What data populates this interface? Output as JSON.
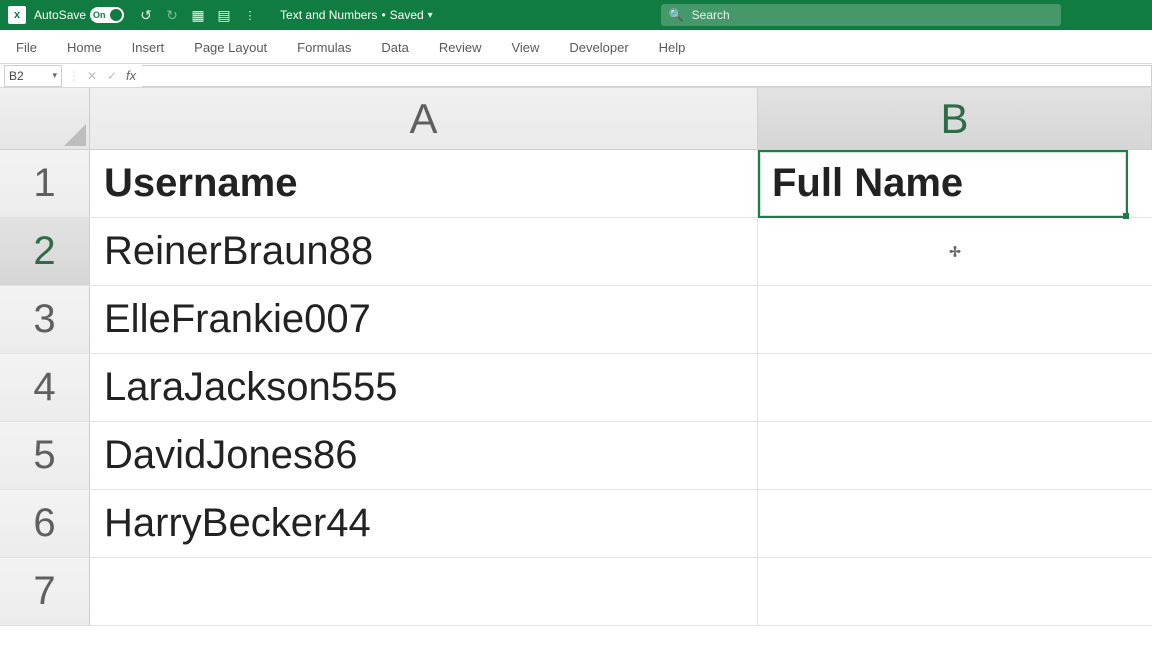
{
  "titlebar": {
    "autosave_label": "AutoSave",
    "toggle_state": "On",
    "file_name": "Text and Numbers",
    "save_status": "Saved",
    "search_placeholder": "Search"
  },
  "ribbon": {
    "tabs": [
      "File",
      "Home",
      "Insert",
      "Page Layout",
      "Formulas",
      "Data",
      "Review",
      "View",
      "Developer",
      "Help"
    ]
  },
  "formula_bar": {
    "name_box": "B2",
    "fx_label": "fx",
    "formula_value": ""
  },
  "grid": {
    "columns": [
      "A",
      "B"
    ],
    "active_cell": "B2",
    "rows": [
      {
        "n": "1",
        "A": "Username",
        "B": "Full Name",
        "bold": true
      },
      {
        "n": "2",
        "A": "ReinerBraun88",
        "B": "",
        "bold": false
      },
      {
        "n": "3",
        "A": "ElleFrankie007",
        "B": "",
        "bold": false
      },
      {
        "n": "4",
        "A": "LaraJackson555",
        "B": "",
        "bold": false
      },
      {
        "n": "5",
        "A": "DavidJones86",
        "B": "",
        "bold": false
      },
      {
        "n": "6",
        "A": "HarryBecker44",
        "B": "",
        "bold": false
      },
      {
        "n": "7",
        "A": "",
        "B": "",
        "bold": false
      }
    ]
  }
}
